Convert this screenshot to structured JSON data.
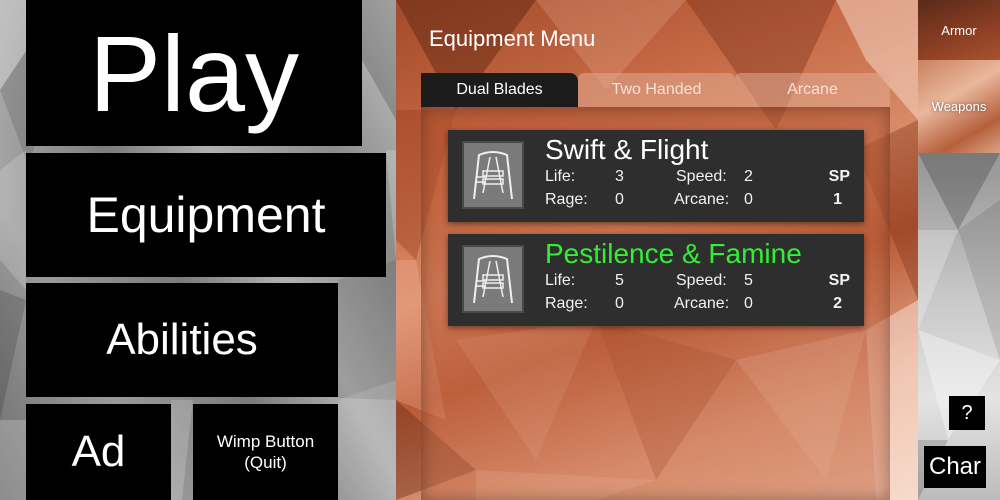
{
  "main_menu": {
    "play": "Play",
    "equipment": "Equipment",
    "abilities": "Abilities",
    "ad": "Ad",
    "quit_line1": "Wimp Button",
    "quit_line2": "(Quit)"
  },
  "equipment_menu": {
    "title": "Equipment Menu",
    "tabs": [
      {
        "label": "Dual Blades",
        "active": true
      },
      {
        "label": "Two Handed",
        "active": false
      },
      {
        "label": "Arcane",
        "active": false
      }
    ],
    "stat_labels": {
      "life": "Life:",
      "rage": "Rage:",
      "speed": "Speed:",
      "arcane": "Arcane:",
      "sp": "SP"
    },
    "items": [
      {
        "name": "Swift & Flight",
        "life": "3",
        "rage": "0",
        "speed": "2",
        "arcane": "0",
        "sp": "1",
        "highlighted": false,
        "icon": "dual-blades-icon"
      },
      {
        "name": "Pestilence & Famine",
        "life": "5",
        "rage": "0",
        "speed": "5",
        "arcane": "0",
        "sp": "2",
        "highlighted": true,
        "icon": "dual-blades-icon"
      }
    ]
  },
  "side_nav": {
    "armor": "Armor",
    "weapons": "Weapons"
  },
  "help": "?",
  "char": "Char",
  "colors": {
    "highlight_name": "#33ee33",
    "button_bg": "#000000",
    "card_bg": "#2e2e2e"
  }
}
